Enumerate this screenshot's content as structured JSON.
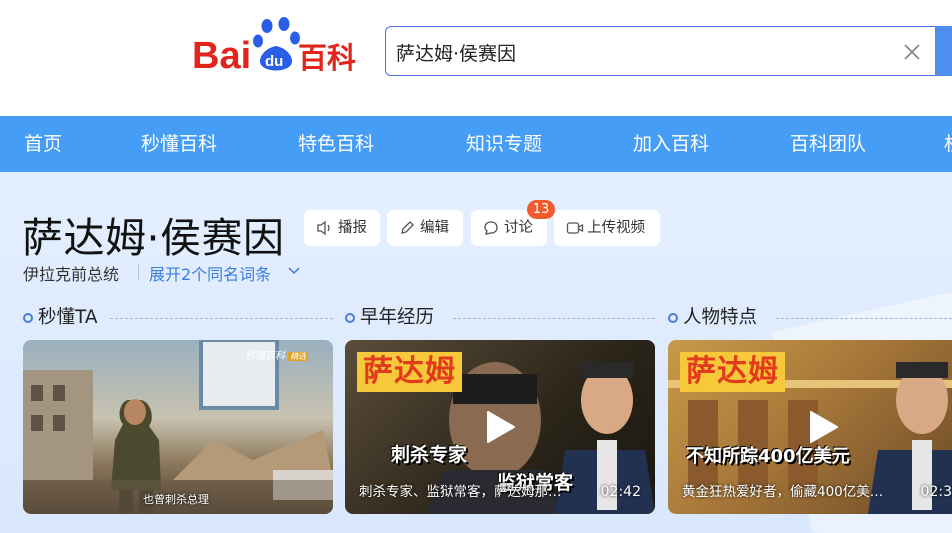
{
  "logo": {
    "bai": "Bai",
    "du": "du",
    "baike": "百科"
  },
  "search": {
    "value": "萨达姆·侯赛因",
    "placeholder": ""
  },
  "nav": {
    "items": [
      "首页",
      "秒懂百科",
      "特色百科",
      "知识专题",
      "加入百科",
      "百科团队",
      "权"
    ]
  },
  "entry": {
    "title": "萨达姆·侯赛因",
    "subtitle": "伊拉克前总统",
    "expand_label": "展开2个同名词条",
    "actions": {
      "broadcast": "播报",
      "edit": "编辑",
      "discuss": "讨论",
      "discuss_count": "13",
      "upload": "上传视频"
    }
  },
  "sections": [
    {
      "title": "秒懂TA"
    },
    {
      "title": "早年经历"
    },
    {
      "title": "人物特点"
    }
  ],
  "videos": [
    {
      "caption": "也曾刺杀总理",
      "watermark": "秒懂百科",
      "watermark_tag": "精选",
      "duration": ""
    },
    {
      "banner": "萨达姆",
      "mid_text": "刺杀专家",
      "mid_text2": "监狱常客",
      "caption": "刺杀专家、监狱常客，萨达姆那…",
      "duration": "02:42"
    },
    {
      "banner": "萨达姆",
      "mid_text": "不知所踪400亿美元",
      "caption": "黄金狂热爱好者，偷藏400亿美…",
      "duration": "02:3"
    }
  ],
  "colors": {
    "nav_bg": "#459df5",
    "accent": "#4e6ef2",
    "badge": "#f25a2c",
    "link": "#3a7de0"
  }
}
